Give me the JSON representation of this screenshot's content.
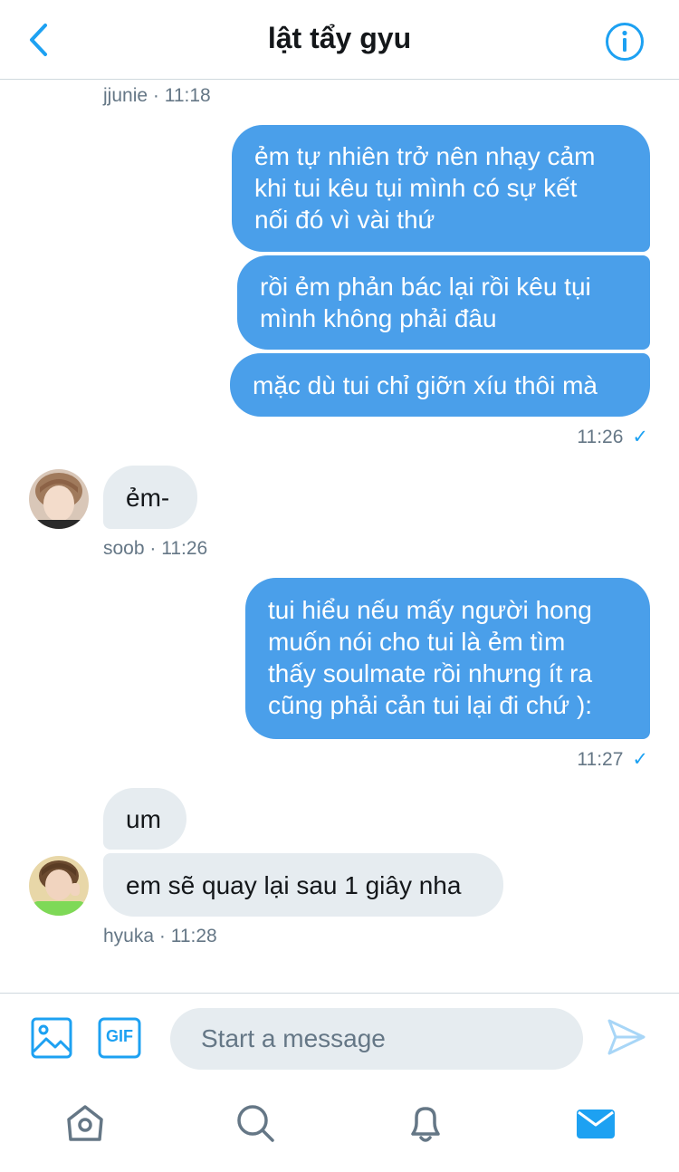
{
  "header": {
    "title": "lật tẩy gyu",
    "back_icon": "chevron-left-icon",
    "info_icon": "info-icon"
  },
  "messages": {
    "m1_meta": {
      "sender": "jjunie",
      "sep": "·",
      "time": "11:18"
    },
    "group1": {
      "bubbles": [
        [
          "ẻm tự nhiên trở nên nhạy cảm",
          "khi tui kêu tụi mình có sự kết",
          "nối đó vì vài thứ"
        ],
        [
          "rồi ẻm phản bác lại rồi kêu tụi",
          "mình không phải đâu"
        ],
        [
          "mặc dù tui chỉ giỡn xíu thôi mà"
        ]
      ],
      "time": "11:26",
      "check": "✓"
    },
    "group2": {
      "text": "ẻm-",
      "sender": "soob",
      "sep": "·",
      "time": "11:26"
    },
    "group3": {
      "lines": [
        "tui hiểu nếu mấy người hong",
        "muốn nói cho tui là ẻm tìm",
        "thấy soulmate rồi nhưng ít ra",
        "cũng phải cản tui lại đi chứ ):"
      ],
      "time": "11:27",
      "check": "✓"
    },
    "group4": {
      "bubbles": [
        "um",
        "em sẽ quay lại sau 1 giây nha"
      ],
      "sender": "hyuka",
      "sep": "·",
      "time": "11:28"
    }
  },
  "composer": {
    "placeholder": "Start a message",
    "gif_label": "GIF",
    "image_icon": "image-icon",
    "send_icon": "send-icon"
  },
  "tabbar": {
    "items": [
      "home-icon",
      "search-icon",
      "bell-icon",
      "mail-icon"
    ],
    "active": "mail-icon"
  },
  "colors": {
    "accent": "#1da1f2",
    "outgoing_bubble": "#4a9fea",
    "incoming_bubble": "#e6ecf0",
    "meta_text": "#657786"
  }
}
